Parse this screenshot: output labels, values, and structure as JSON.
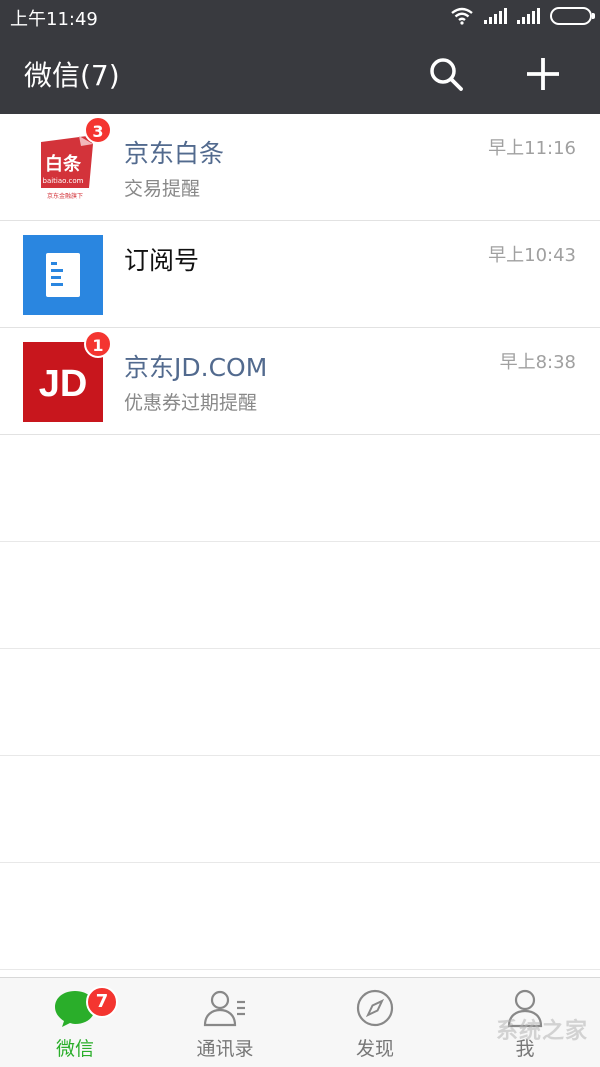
{
  "status_bar": {
    "time": "上午11:49"
  },
  "header": {
    "title": "微信(7)"
  },
  "chats": [
    {
      "name": "京东白条",
      "preview": "交易提醒",
      "time": "早上11:16",
      "badge": "3",
      "avatar_text": "白条",
      "avatar_subtext": "baitiao.com",
      "avatar_caption": "京东金融旗下"
    },
    {
      "name": "订阅号",
      "preview": "",
      "time": "早上10:43"
    },
    {
      "name": "京东JD.COM",
      "preview": "优惠券过期提醒",
      "time": "早上8:38",
      "badge": "1",
      "avatar_text": "JD"
    }
  ],
  "tabbar": {
    "tabs": [
      {
        "label": "微信",
        "badge": "7"
      },
      {
        "label": "通讯录"
      },
      {
        "label": "发现"
      },
      {
        "label": "我"
      }
    ]
  },
  "watermark": "系统之家",
  "colors": {
    "header_bg": "#393a3f",
    "accent_green": "#2aae2a",
    "badge_red": "#f43530",
    "name_blue": "#526a8e"
  }
}
